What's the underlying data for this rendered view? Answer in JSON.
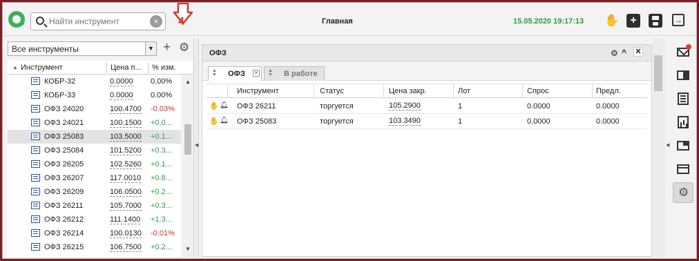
{
  "header": {
    "search_placeholder": "Найти инструмент",
    "clear_label": "×",
    "title": "Главная",
    "datetime": "15.05.2020 19:17:13"
  },
  "annotation": {
    "number": "4",
    "color": "#d4352b"
  },
  "left_panel": {
    "filter_value": "Все инструменты",
    "columns": {
      "instrument": "Инструмент",
      "price": "Цена п...",
      "change": "% изм."
    },
    "rows": [
      {
        "name": "КОБР-32",
        "price": "0.0000",
        "change": "0.00%",
        "trend": "flat"
      },
      {
        "name": "КОБР-33",
        "price": "0.0000",
        "change": "0.00%",
        "trend": "flat"
      },
      {
        "name": "ОФЗ 24020",
        "price": "100.4700",
        "change": "-0.03%",
        "trend": "down"
      },
      {
        "name": "ОФЗ 24021",
        "price": "100.1500",
        "change": "+0.0...",
        "trend": "up"
      },
      {
        "name": "ОФЗ 25083",
        "price": "103.5000",
        "change": "+0.1...",
        "trend": "up",
        "selected": true
      },
      {
        "name": "ОФЗ 25084",
        "price": "101.5200",
        "change": "+0.3...",
        "trend": "up"
      },
      {
        "name": "ОФЗ 26205",
        "price": "102.5260",
        "change": "+0.1...",
        "trend": "up"
      },
      {
        "name": "ОФЗ 26207",
        "price": "117.0010",
        "change": "+0.8...",
        "trend": "up"
      },
      {
        "name": "ОФЗ 26209",
        "price": "106.0500",
        "change": "+0.2...",
        "trend": "up"
      },
      {
        "name": "ОФЗ 26211",
        "price": "105.7000",
        "change": "+0.3...",
        "trend": "up"
      },
      {
        "name": "ОФЗ 26212",
        "price": "111.1400",
        "change": "+1.3...",
        "trend": "up"
      },
      {
        "name": "ОФЗ 26214",
        "price": "100.0130",
        "change": "-0.01%",
        "trend": "down"
      },
      {
        "name": "ОФЗ 26215",
        "price": "106.7500",
        "change": "+0.2...",
        "trend": "up"
      }
    ]
  },
  "widget": {
    "title": "ОФЗ",
    "tabs": [
      {
        "label": "ОФЗ",
        "active": true
      },
      {
        "label": "В работе",
        "active": false
      }
    ],
    "columns": [
      "Инструмент",
      "Статус",
      "Цена закр.",
      "Лот",
      "Спрос",
      "Предл."
    ],
    "rows": [
      {
        "instrument": "ОФЗ 26211",
        "status": "торгуется",
        "close": "105.2900",
        "lot": "1",
        "bid": "0.0000",
        "ask": "0.0000"
      },
      {
        "instrument": "ОФЗ 25083",
        "status": "торгуется",
        "close": "103.3490",
        "lot": "1",
        "bid": "0.0000",
        "ask": "0.0000"
      }
    ]
  },
  "sidebar_icons": [
    "mail-icon",
    "panel-icon",
    "list-icon",
    "chart-icon",
    "window-icon",
    "card-icon",
    "settings-icon"
  ],
  "colors": {
    "accent_green": "#2e9a3e",
    "negative_red": "#c0392b",
    "notification_red": "#e23b3b"
  }
}
